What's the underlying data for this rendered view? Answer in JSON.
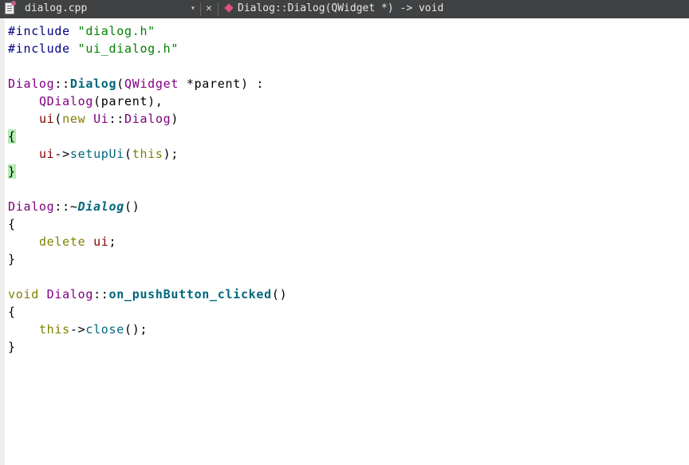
{
  "toolbar": {
    "file_name": "dialog.cpp",
    "dropdown_glyph": "▾",
    "close_glyph": "✕",
    "current_symbol": "Dialog::Dialog(QWidget *) -> void"
  },
  "editor": {
    "lines": [
      [
        {
          "t": "#include",
          "c": "pp"
        },
        {
          "t": " "
        },
        {
          "t": "\"dialog.h\"",
          "c": "str"
        }
      ],
      [
        {
          "t": "#include",
          "c": "pp"
        },
        {
          "t": " "
        },
        {
          "t": "\"ui_dialog.h\"",
          "c": "str"
        }
      ],
      [],
      [
        {
          "t": "Dialog",
          "c": "type"
        },
        {
          "t": "::"
        },
        {
          "t": "Dialog",
          "c": "fn"
        },
        {
          "t": "("
        },
        {
          "t": "QWidget",
          "c": "type"
        },
        {
          "t": " *parent) :"
        }
      ],
      [
        {
          "t": "    "
        },
        {
          "t": "QDialog",
          "c": "type"
        },
        {
          "t": "(parent),"
        }
      ],
      [
        {
          "t": "    "
        },
        {
          "t": "ui",
          "c": "mem"
        },
        {
          "t": "("
        },
        {
          "t": "new",
          "c": "kw"
        },
        {
          "t": " "
        },
        {
          "t": "Ui",
          "c": "type"
        },
        {
          "t": "::"
        },
        {
          "t": "Dialog",
          "c": "type"
        },
        {
          "t": ")"
        }
      ],
      [
        {
          "t": "{",
          "c": "brace-hl"
        }
      ],
      [
        {
          "t": "    "
        },
        {
          "t": "ui",
          "c": "mem"
        },
        {
          "t": "->"
        },
        {
          "t": "setupUi",
          "c": "call"
        },
        {
          "t": "("
        },
        {
          "t": "this",
          "c": "kw"
        },
        {
          "t": ");"
        }
      ],
      [
        {
          "t": "}",
          "c": "brace-hl"
        }
      ],
      [],
      [
        {
          "t": "Dialog",
          "c": "type"
        },
        {
          "t": "::~"
        },
        {
          "t": "Dialog",
          "c": "fni"
        },
        {
          "t": "()"
        }
      ],
      [
        {
          "t": "{"
        }
      ],
      [
        {
          "t": "    "
        },
        {
          "t": "delete",
          "c": "kw"
        },
        {
          "t": " "
        },
        {
          "t": "ui",
          "c": "mem"
        },
        {
          "t": ";"
        }
      ],
      [
        {
          "t": "}"
        }
      ],
      [],
      [
        {
          "t": "void",
          "c": "kw"
        },
        {
          "t": " "
        },
        {
          "t": "Dialog",
          "c": "type"
        },
        {
          "t": "::"
        },
        {
          "t": "on_pushButton_clicked",
          "c": "fn"
        },
        {
          "t": "()"
        }
      ],
      [
        {
          "t": "{"
        }
      ],
      [
        {
          "t": "    "
        },
        {
          "t": "this",
          "c": "kw"
        },
        {
          "t": "->"
        },
        {
          "t": "close",
          "c": "call"
        },
        {
          "t": "();"
        }
      ],
      [
        {
          "t": "}"
        }
      ]
    ]
  }
}
